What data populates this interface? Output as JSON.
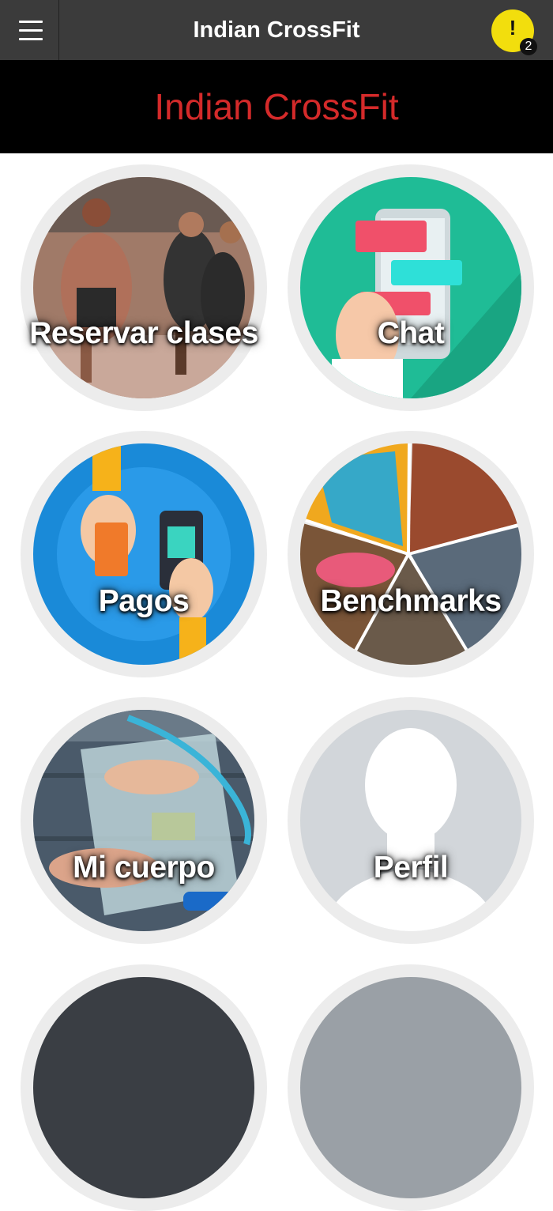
{
  "header": {
    "title": "Indian CrossFit",
    "menu_icon": "hamburger-menu-icon",
    "alert_icon": "exclamation-icon",
    "alert_symbol": "!",
    "alert_count": "2"
  },
  "banner": {
    "title": "Indian CrossFit",
    "title_color": "#d42a2a"
  },
  "tiles": [
    {
      "label": "Reservar clases",
      "image": "crossfit-athletes-running-photo"
    },
    {
      "label": "Chat",
      "image": "chat-phone-illustration"
    },
    {
      "label": "Pagos",
      "image": "card-payment-illustration"
    },
    {
      "label": "Benchmarks",
      "image": "sports-collage-photo"
    },
    {
      "label": "Mi cuerpo",
      "image": "scale-and-measuring-tape-photo"
    },
    {
      "label": "Perfil",
      "image": "profile-silhouette-placeholder"
    }
  ],
  "colors": {
    "topbar": "#3b3b3b",
    "alert_badge": "#f2de0d",
    "tile_ring": "#ececec"
  }
}
